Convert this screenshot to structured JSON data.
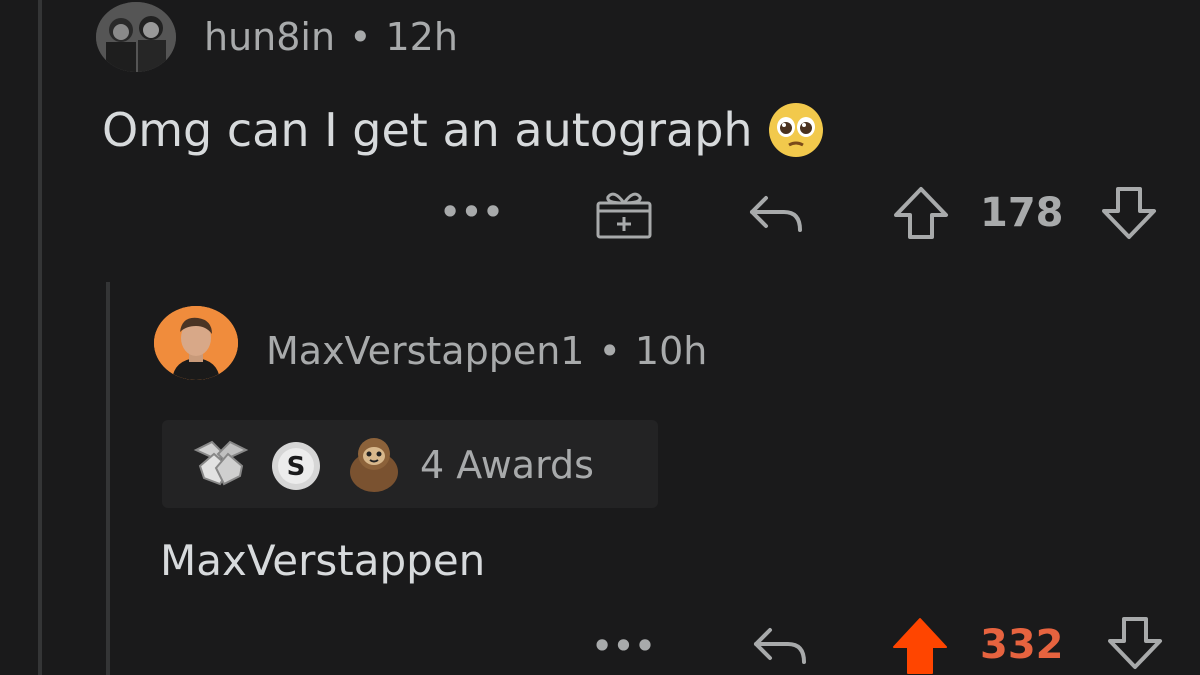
{
  "parent_comment": {
    "username": "hun8in",
    "separator": "•",
    "time": "12h",
    "text": "Omg can I get an autograph",
    "emoji": "pleading-face-emoji",
    "actions": {
      "more_label": "•••",
      "score": "178"
    }
  },
  "reply_comment": {
    "username": "MaxVerstappen1",
    "separator": "•",
    "time": "10h",
    "awards": {
      "icons": [
        "handshake-award-icon",
        "silver-coin-award-icon",
        "sloth-award-icon"
      ],
      "label": "4 Awards"
    },
    "text": "MaxVerstappen",
    "actions": {
      "more_label": "•••",
      "score": "332",
      "upvoted": true
    }
  },
  "colors": {
    "background": "#1a1a1b",
    "text": "#d7dadc",
    "muted": "#a8aaab",
    "upvote_active": "#ff4500",
    "upvote_score_active": "#e6633f",
    "reply_avatar_bg": "#f08c3c"
  }
}
